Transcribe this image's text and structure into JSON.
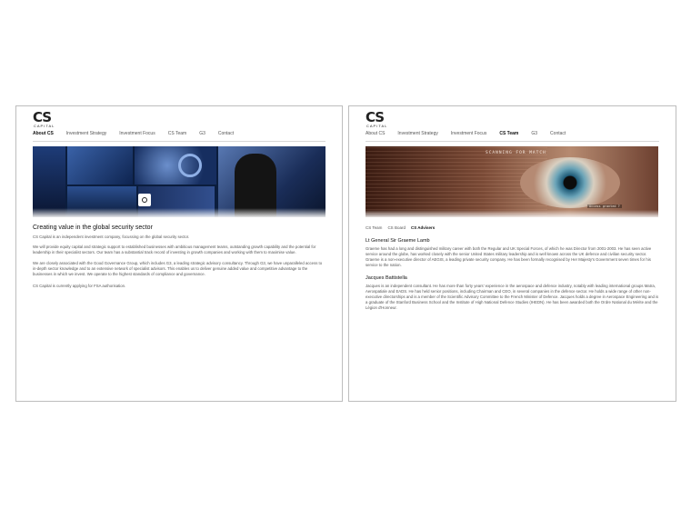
{
  "left": {
    "logo": {
      "mark": "CS",
      "sub": "CAPITAL"
    },
    "nav": [
      "About CS",
      "Investment Strategy",
      "Investment Focus",
      "CS Team",
      "G3",
      "Contact"
    ],
    "heading": "Creating value in the global security sector",
    "paragraphs": [
      "CS Capital is an independent investment company, focussing on the global security sector.",
      "We will provide equity capital and strategic support to established businesses with ambitious management teams, outstanding growth capability and the potential for leadership in their specialist sectors. Our team has a substantial track record of investing in growth companies and working with them to maximise value.",
      "We are closely associated with the Good Governance Group, which includes G3, a leading strategic advisory consultancy. Through G3, we have unparalleled access to in-depth sector knowledge and to an extensive network of specialist advisors. This enables us to deliver genuine added value and competitive advantage to the businesses in which we invest. We operate to the highest standards of compliance and governance.",
      "CS Capital is currently applying for FSA authorisation."
    ]
  },
  "right": {
    "logo": {
      "mark": "CS",
      "sub": "CAPITAL"
    },
    "nav": [
      "About CS",
      "Investment Strategy",
      "Investment Focus",
      "CS Team",
      "G3",
      "Contact"
    ],
    "hero_text": {
      "scan": "SCANNING FOR MATCH",
      "grant": "Access granted ?"
    },
    "subnav": [
      "CS Team",
      "CS Board",
      "CS Advisers"
    ],
    "people": [
      {
        "name": "Lt General Sir Graeme Lamb",
        "bio": "Graeme has had a long and distinguished military career with both the Regular and UK Special Forces, of which he was Director from 2001-2003. He has seen active service around the globe, has worked closely with the senior United States military leadership and is well known across the UK defence and civilian security sector. Graeme is a non-executive director of AEGIS, a leading private security company. He has been formally recognised by Her Majesty's Government seven times for his service to the nation."
      },
      {
        "name": "Jacques Battistella",
        "bio": "Jacques is an independent consultant. He has more than forty years' experience in the aerospace and defence industry, notably with leading international groups Matra, Aerospatiale and EADS. He has held senior positions, including Chairman and CEO, in several companies in the defence sector. He holds a wide range of other non-executive directorships and is a member of the Scientific Advisory Committee to the French Minister of Defence. Jacques holds a degree in Aerospace Engineering and is a graduate of the Stanford Business School and the Institute of High National Defence Studies (IHEDN). He has been awarded both the Ordre National du Mérite and the Légion d'Honneur."
      }
    ]
  }
}
